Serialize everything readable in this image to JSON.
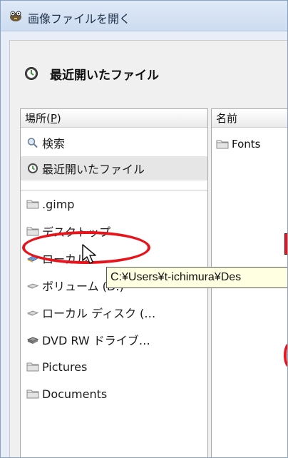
{
  "window": {
    "title": "画像ファイルを開く"
  },
  "header": {
    "recent_label": "最近開いたファイル"
  },
  "places": {
    "column_label": "場所(P)",
    "column_label_pre": "場所(",
    "column_label_key": "P",
    "column_label_post": ")",
    "items": [
      {
        "label": "検索",
        "icon": "search-icon"
      },
      {
        "label": "最近開いたファイル",
        "icon": "recent-icon"
      },
      {
        "label": ".gimp",
        "icon": "folder-icon"
      },
      {
        "label": "デスクトップ",
        "icon": "folder-icon"
      },
      {
        "label": "ローカル",
        "icon": "drive-icon"
      },
      {
        "label": "ボリューム (D:)",
        "icon": "drive-icon"
      },
      {
        "label": "ローカル ディスク (…",
        "icon": "drive-icon"
      },
      {
        "label": "DVD RW ドライブ…",
        "icon": "dvd-drive-icon"
      },
      {
        "label": "Pictures",
        "icon": "folder-icon"
      },
      {
        "label": "Documents",
        "icon": "folder-icon"
      }
    ]
  },
  "files": {
    "column_label": "名前",
    "items": [
      {
        "label": "Fonts",
        "icon": "folder-icon"
      }
    ]
  },
  "tooltip": {
    "text": "C:¥Users¥t-ichimura¥Des"
  },
  "colors": {
    "annotation": "#e8141b",
    "tooltip_bg": "#ffffe1"
  }
}
